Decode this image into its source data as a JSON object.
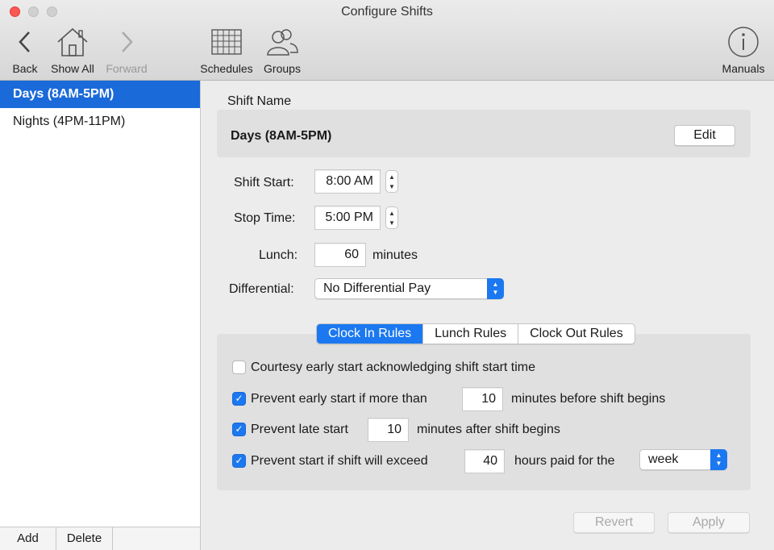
{
  "window": {
    "title": "Configure Shifts"
  },
  "toolbar": {
    "back": "Back",
    "show_all": "Show All",
    "forward": "Forward",
    "schedules": "Schedules",
    "groups": "Groups",
    "manuals": "Manuals"
  },
  "sidebar": {
    "items": [
      {
        "label": "Days (8AM-5PM)",
        "selected": true
      },
      {
        "label": "Nights (4PM-11PM)",
        "selected": false
      }
    ],
    "add_label": "Add",
    "delete_label": "Delete"
  },
  "shift": {
    "name_label": "Shift Name",
    "name_value": "Days (8AM-5PM)",
    "edit_label": "Edit",
    "start_label": "Shift Start:",
    "start_value": "8:00 AM",
    "stop_label": "Stop Time:",
    "stop_value": "5:00 PM",
    "lunch_label": "Lunch:",
    "lunch_value": "60",
    "lunch_unit": "minutes",
    "differential_label": "Differential:",
    "differential_value": "No Differential Pay"
  },
  "tabs": [
    {
      "label": "Clock In Rules",
      "active": true
    },
    {
      "label": "Lunch Rules",
      "active": false
    },
    {
      "label": "Clock Out Rules",
      "active": false
    }
  ],
  "rules": {
    "courtesy": {
      "label": "Courtesy early start acknowledging shift start time",
      "checked": false
    },
    "early": {
      "label": "Prevent early start if more than",
      "checked": true,
      "value": "10",
      "suffix": "minutes before shift begins"
    },
    "late": {
      "label": "Prevent late start",
      "checked": true,
      "value": "10",
      "suffix": "minutes after shift begins"
    },
    "exceed": {
      "label": "Prevent start if shift will exceed",
      "checked": true,
      "value": "40",
      "suffix": "hours paid for the",
      "period": "week"
    }
  },
  "footer": {
    "revert_label": "Revert",
    "apply_label": "Apply"
  },
  "colors": {
    "accent": "#1b78f0",
    "selection": "#1b6ad9"
  }
}
